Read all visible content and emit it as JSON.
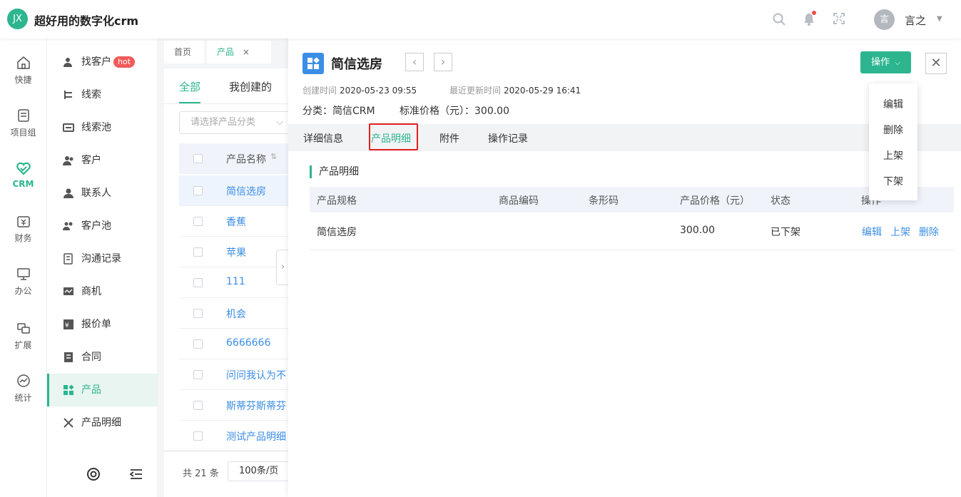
{
  "app": {
    "logo": "JX",
    "title": "超好用的数字化crm"
  },
  "topbar": {
    "user_avatar": "言",
    "user_name": "言之",
    "icons": [
      "search-icon",
      "bell-icon",
      "fullscreen-icon"
    ]
  },
  "leftnav": {
    "items": [
      {
        "label": "快捷",
        "icon": "home-icon"
      },
      {
        "label": "项目组",
        "icon": "document-icon"
      },
      {
        "label": "CRM",
        "icon": "heart-icon",
        "active": true
      },
      {
        "label": "财务",
        "icon": "finance-icon"
      },
      {
        "label": "办公",
        "icon": "monitor-icon"
      },
      {
        "label": "扩展",
        "icon": "extend-icon"
      },
      {
        "label": "统计",
        "icon": "chart-icon"
      }
    ]
  },
  "submenu": {
    "items": [
      {
        "label": "找客户",
        "badge": "hot"
      },
      {
        "label": "线索"
      },
      {
        "label": "线索池"
      },
      {
        "label": "客户"
      },
      {
        "label": "联系人"
      },
      {
        "label": "客户池"
      },
      {
        "label": "沟通记录"
      },
      {
        "label": "商机"
      },
      {
        "label": "报价单"
      },
      {
        "label": "合同"
      },
      {
        "label": "产品",
        "active": true
      },
      {
        "label": "产品明细"
      }
    ]
  },
  "pagetabs": [
    {
      "label": "首页"
    },
    {
      "label": "产品",
      "active": true,
      "close": "×"
    }
  ],
  "list": {
    "tabs": [
      "全部",
      "我创建的"
    ],
    "category_placeholder": "请选择产品分类",
    "column": "产品名称",
    "rows": [
      "简信选房",
      "香蕉",
      "苹果",
      "111",
      "机会",
      "6666666",
      "问问我认为不",
      "斯蒂芬斯蒂芬",
      "测试产品明细"
    ],
    "total": "共 21 条",
    "page_size": "100条/页"
  },
  "detail": {
    "title": "简信选房",
    "op_button": "操作",
    "created_label": "创建时间",
    "created": "2020-05-23 09:55",
    "updated_label": "最近更新时间",
    "updated": "2020-05-29 16:41",
    "category_label": "分类：",
    "category": "简信CRM",
    "price_label": "标准价格（元）：",
    "price": "300.00",
    "tabs": [
      "详细信息",
      "产品明细",
      "附件",
      "操作记录"
    ],
    "active_tab": "产品明细",
    "section_title": "产品明细",
    "table": {
      "headers": [
        "产品规格",
        "商品编码",
        "条形码",
        "产品价格（元）",
        "状态",
        "操作"
      ],
      "rows": [
        {
          "spec": "简信选房",
          "code": "",
          "barcode": "",
          "price": "300.00",
          "status": "已下架",
          "actions": [
            "编辑",
            "上架",
            "删除"
          ]
        }
      ]
    }
  },
  "op_menu": [
    "编辑",
    "删除",
    "上架",
    "下架"
  ],
  "colors": {
    "accent": "#2cb58f",
    "link": "#3b8ee6",
    "highlight": "#e02020"
  }
}
